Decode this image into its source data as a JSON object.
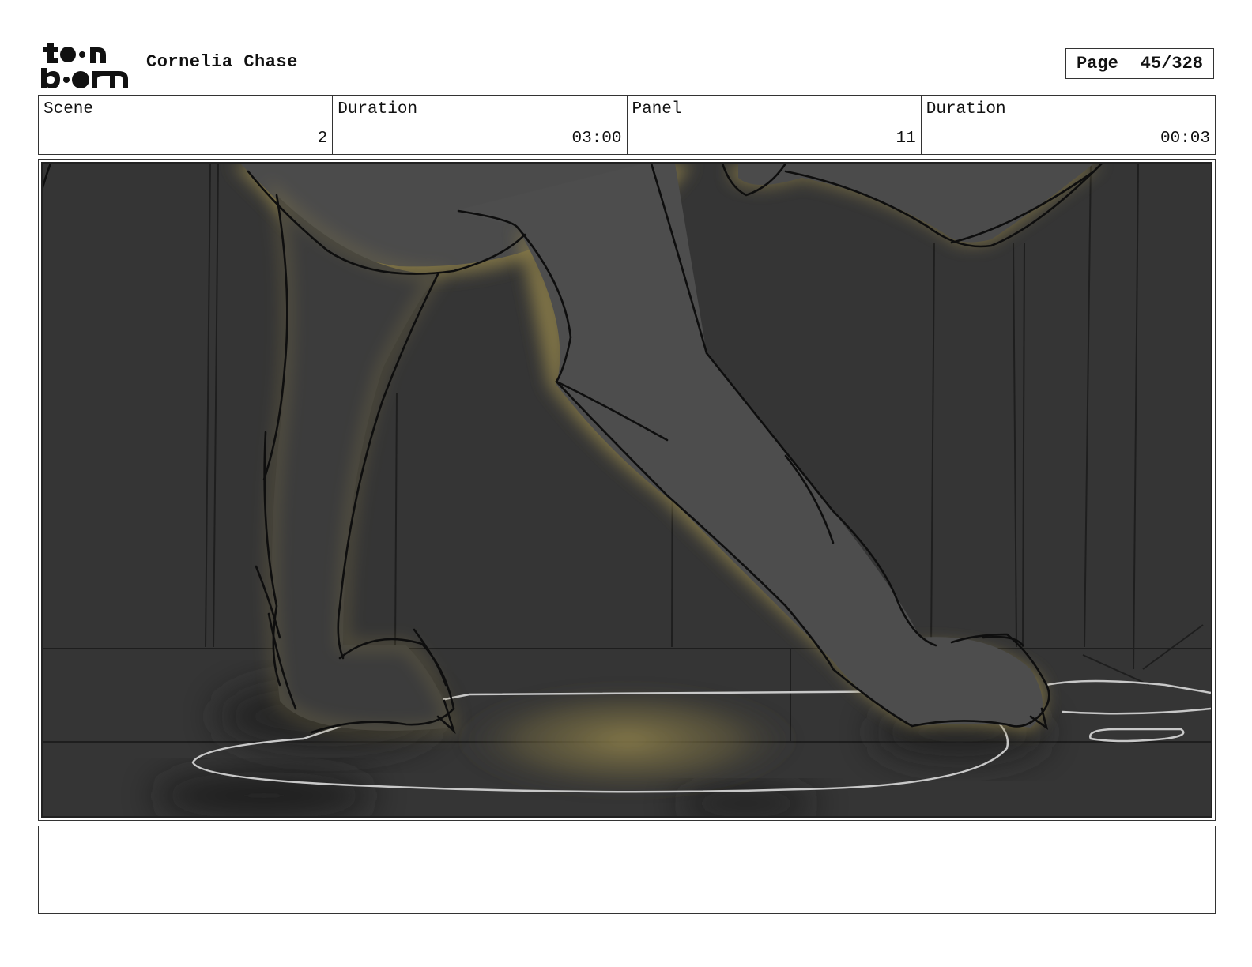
{
  "header": {
    "logo_text": "toonboom",
    "project_title": "Cornelia Chase",
    "page_label": "Page",
    "page_value": "45/328"
  },
  "info": [
    {
      "label": "Scene",
      "value": "2"
    },
    {
      "label": "Duration",
      "value": "03:00"
    },
    {
      "label": "Panel",
      "value": "11"
    },
    {
      "label": "Duration",
      "value": "00:03"
    }
  ],
  "panel": {
    "description": "",
    "colors": {
      "background": "#353535",
      "leg": "#4a4a4a",
      "glow": "#8a7d4a",
      "line": "#111111",
      "puddle": "#cfcfcf"
    }
  },
  "notes": {
    "text": ""
  }
}
